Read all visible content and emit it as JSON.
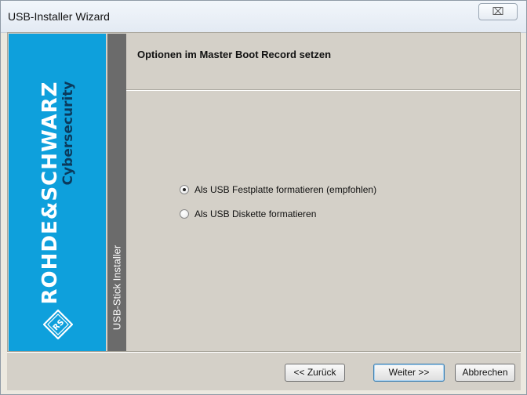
{
  "window": {
    "title": "USB-Installer Wizard",
    "close_glyph": "⌧"
  },
  "brand": {
    "name": "ROHDE&SCHWARZ",
    "subtitle": "Cybersecurity",
    "logo_text": "RS",
    "color": "#0ea0dc"
  },
  "sidebar": {
    "label": "USB-Stick Installer"
  },
  "page": {
    "title": "Optionen im Master Boot Record setzen"
  },
  "options": [
    {
      "label": "Als USB Festplatte formatieren (empfohlen)",
      "selected": true
    },
    {
      "label": "Als USB Diskette formatieren",
      "selected": false
    }
  ],
  "buttons": {
    "back": "<< Zurück",
    "next": "Weiter >>",
    "cancel": "Abbrechen"
  }
}
